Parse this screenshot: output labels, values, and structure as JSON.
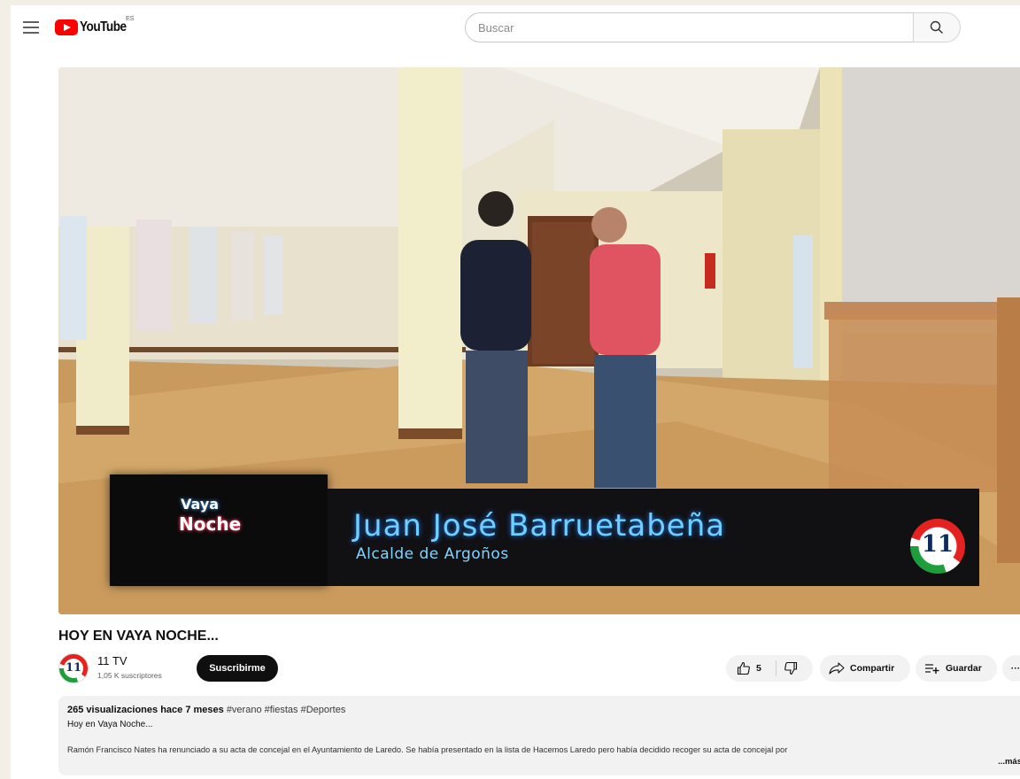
{
  "header": {
    "logo_text": "YouTube",
    "country_code": "ES",
    "search_placeholder": "Buscar"
  },
  "video": {
    "overlay": {
      "show_line1": "Vaya",
      "show_line2": "Noche",
      "name": "Juan José Barruetabeña",
      "role": "Alcalde de Argoños",
      "channel_logo_text": "11"
    },
    "title": "HOY EN VAYA NOCHE..."
  },
  "channel": {
    "avatar_text": "11",
    "name": "11 TV",
    "subscribers": "1,05 K suscriptores",
    "subscribe_label": "Suscribirme"
  },
  "actions": {
    "like_count": "5",
    "share_label": "Compartir",
    "save_label": "Guardar",
    "more_label": "···"
  },
  "description": {
    "views": "265 visualizaciones",
    "date": "hace 7 meses",
    "tags": "#verano #fiestas #Deportes",
    "first_line": "Hoy en Vaya Noche...",
    "body": "Ramón Francisco Nates ha renunciado a su acta de concejal en el Ayuntamiento de Laredo. Se había presentado en la lista de Hacemos Laredo pero había decidido recoger su acta de concejal por",
    "more_label": "...más"
  },
  "colors": {
    "brand_red": "#ff0000",
    "pill_bg": "#f2f2f2",
    "subscribe_bg": "#0f0f0f"
  }
}
